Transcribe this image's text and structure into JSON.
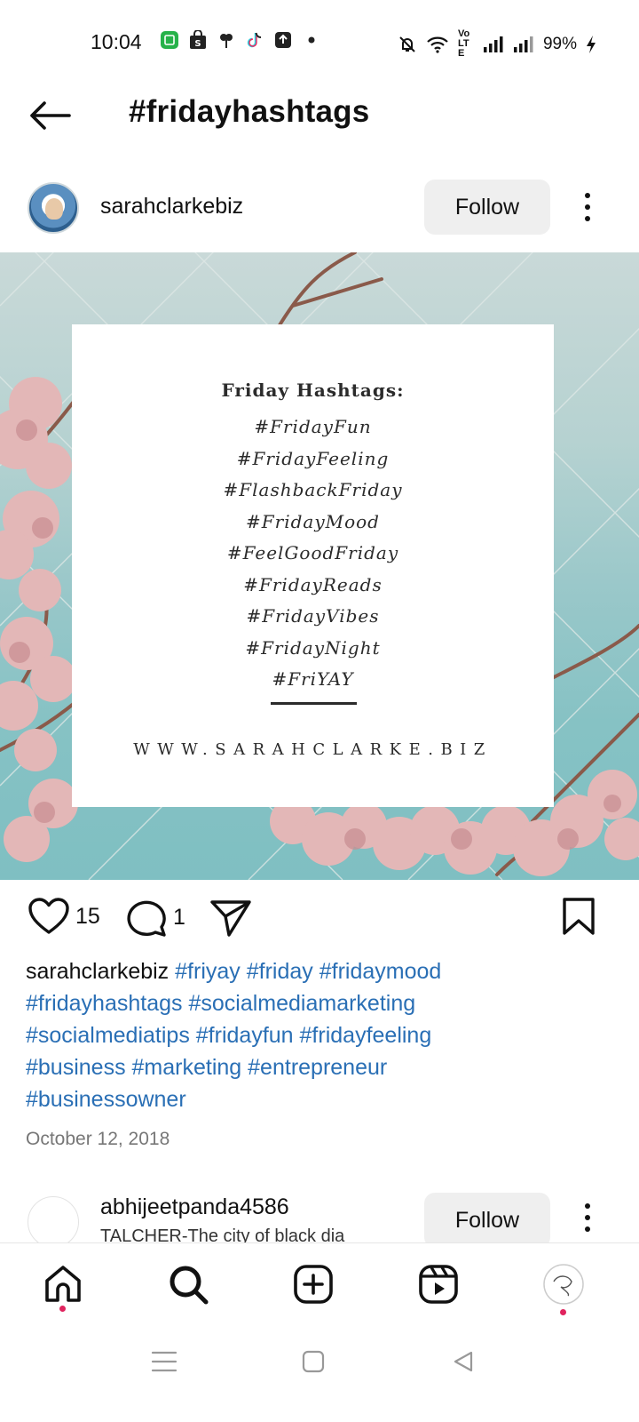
{
  "status_bar": {
    "time": "10:04",
    "battery": "99%",
    "icons_left": [
      "chat-app-icon",
      "shopping-bag-icon",
      "flower-icon",
      "tiktok-icon",
      "upload-icon",
      "dot-icon"
    ],
    "icons_right": [
      "mute-bell-icon",
      "wifi-icon",
      "volte-icon",
      "signal-icon",
      "signal-icon",
      "charging-icon"
    ],
    "volte_label": "Vo LTE"
  },
  "header": {
    "title": "#fridayhashtags"
  },
  "post": {
    "username": "sarahclarkebiz",
    "follow_label": "Follow",
    "image": {
      "title": "Friday Hashtags:",
      "tags": [
        "#FridayFun",
        "#FridayFeeling",
        "#FlashbackFriday",
        "#FridayMood",
        "#FeelGoodFriday",
        "#FridayReads",
        "#FridayVibes",
        "#FridayNight",
        "#FriYAY"
      ],
      "url": "WWW.SARAHCLARKE.BIZ"
    },
    "likes": "15",
    "comments": "1",
    "caption_user": "sarahclarkebiz",
    "caption_tags": [
      "#friyay",
      "#friday",
      "#fridaymood",
      "#fridayhashtags",
      "#socialmediamarketing",
      "#socialmediatips",
      "#fridayfun",
      "#fridayfeeling",
      "#business",
      "#marketing",
      "#entrepreneur",
      "#businessowner"
    ],
    "date": "October 12, 2018"
  },
  "next_post": {
    "username": "abhijeetpanda4586",
    "subtitle": "TALCHER-The city of black dia",
    "follow_label": "Follow"
  },
  "colors": {
    "link": "#2a6fb5",
    "follow_bg": "#efefef",
    "notification_dot": "#e0245e"
  }
}
